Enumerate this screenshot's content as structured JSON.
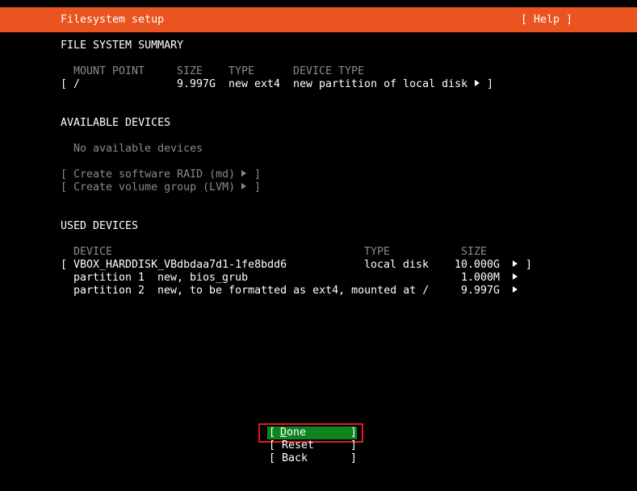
{
  "title_bar": {
    "title": "Filesystem setup",
    "help_label": "[ Help ]"
  },
  "summary": {
    "heading": "FILE SYSTEM SUMMARY",
    "columns": {
      "mount_point": "MOUNT POINT",
      "size": "SIZE",
      "type": "TYPE",
      "device_type": "DEVICE TYPE"
    },
    "rows": [
      {
        "open_bracket": "[",
        "mount_point": "/",
        "size": "9.997G",
        "type": "new ext4",
        "device_type": "new partition of local disk",
        "close_bracket": "]"
      }
    ]
  },
  "available": {
    "heading": "AVAILABLE DEVICES",
    "empty_text": "No available devices",
    "raid_label": "[ Create software RAID (md)",
    "raid_close": "]",
    "lvm_label": "[ Create volume group (LVM)",
    "lvm_close": "]"
  },
  "used": {
    "heading": "USED DEVICES",
    "columns": {
      "device": "DEVICE",
      "type": "TYPE",
      "size": "SIZE"
    },
    "disk": {
      "open_bracket": "[",
      "device": "VBOX_HARDDISK_VBdbdaa7d1-1fe8bdd6",
      "type": "local disk",
      "size": "10.000G",
      "close_bracket": "]"
    },
    "partitions": [
      {
        "name": "partition 1",
        "desc": "new, bios_grub",
        "size": "1.000M"
      },
      {
        "name": "partition 2",
        "desc": "new, to be formatted as ext4, mounted at /",
        "size": "9.997G"
      }
    ]
  },
  "buttons": {
    "done": {
      "open": "[ ",
      "accel": "D",
      "rest": "one",
      "close": "]"
    },
    "reset": {
      "label": "[ Reset",
      "close": "]"
    },
    "back": {
      "label": "[ Back",
      "close": "]"
    }
  },
  "colors": {
    "accent": "#e95420",
    "focus_button": "#0e8420",
    "focus_ring": "#e01b24",
    "dim_text": "#8a8a8a",
    "background": "#000000"
  }
}
